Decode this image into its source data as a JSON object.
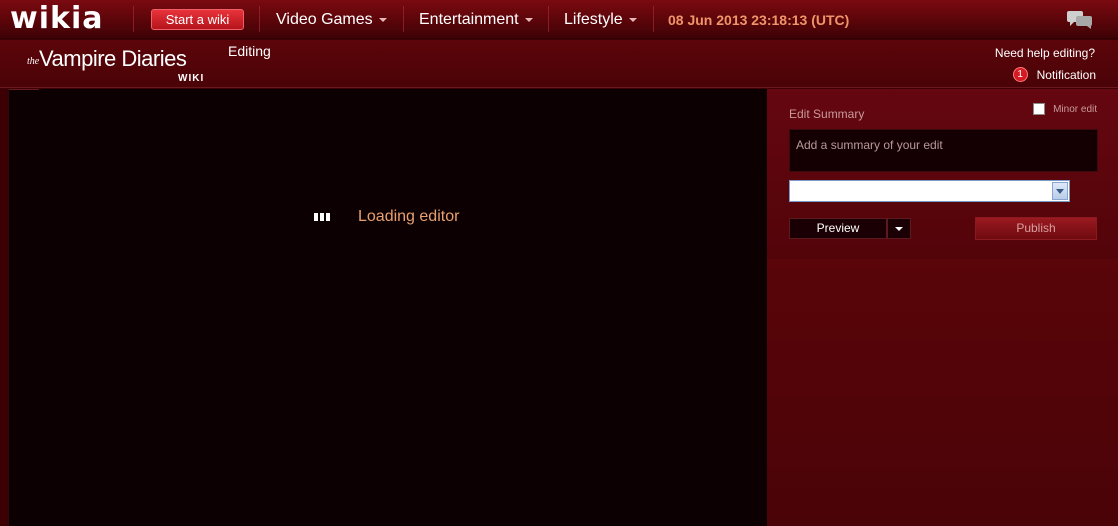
{
  "global_nav": {
    "logo": "wikia",
    "start_wiki_label": "Start a wiki",
    "items": [
      {
        "label": "Video Games"
      },
      {
        "label": "Entertainment"
      },
      {
        "label": "Lifestyle"
      }
    ],
    "datetime": "08 Jun 2013 23:18:13 (UTC)",
    "chat_icon": "speech-bubbles-icon"
  },
  "header": {
    "wordmark": {
      "prefix": "the",
      "title": "Vampire Diaries",
      "suffix": "WIKI"
    },
    "editing_label": "Editing",
    "help_link": "Need help editing?",
    "notification": {
      "count": "1",
      "label": "Notification"
    }
  },
  "editor": {
    "loading_text": "Loading editor"
  },
  "rail": {
    "summary_label": "Edit Summary",
    "minor_edit_label": "Minor edit",
    "summary_placeholder": "Add a summary of your edit",
    "select_value": "",
    "preview_label": "Preview",
    "publish_label": "Publish"
  },
  "colors": {
    "background": "#3c0004",
    "editor_bg": "#0c0002",
    "accent_red": "#d41a22",
    "datetime": "#f0956a",
    "loading_text": "#e8a070"
  }
}
